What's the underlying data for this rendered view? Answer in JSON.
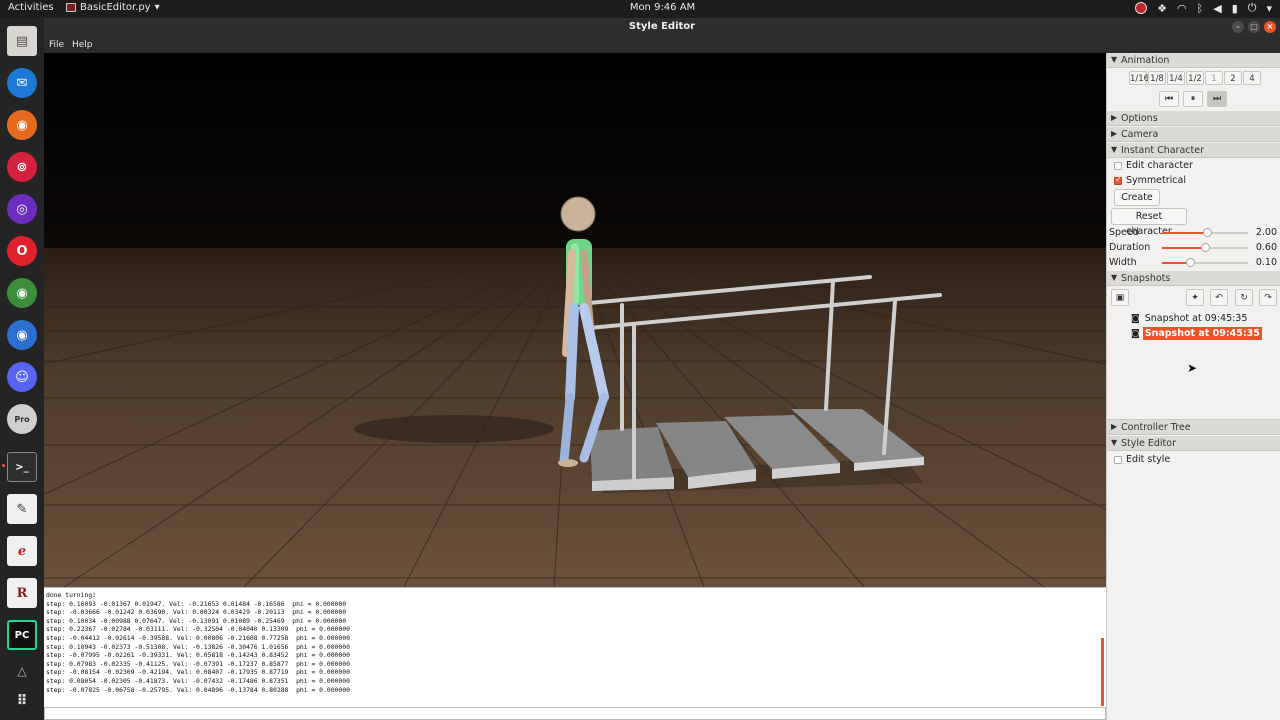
{
  "system": {
    "activities": "Activities",
    "app_name": "BasicEditor.py",
    "clock": "Mon  9:46 AM"
  },
  "window": {
    "title": "Style Editor"
  },
  "menu": {
    "file": "File",
    "help": "Help"
  },
  "dock": {
    "items": [
      "file-manager-icon",
      "thunderbird-icon",
      "firefox-icon",
      "app-icon-red",
      "app-icon-purple",
      "opera-icon",
      "chrome-icon",
      "chromium-icon",
      "discord-icon",
      "sheets-pro-icon",
      "terminal-icon",
      "text-editor-icon",
      "ebook-viewer-icon",
      "r-studio-icon",
      "pycharm-icon",
      "inkscape-icon",
      "show-apps-icon"
    ],
    "pro_label": "Pro",
    "r_label": "R",
    "pc_label": "PC"
  },
  "panel": {
    "animation": {
      "header": "Animation",
      "speeds": [
        "1/16",
        "1/8",
        "1/4",
        "1/2",
        "1",
        "2",
        "4"
      ]
    },
    "options_header": "Options",
    "camera_header": "Camera",
    "instant_character": {
      "header": "Instant Character",
      "edit_character": "Edit character",
      "symmetrical": "Symmetrical",
      "symmetrical_checked": true,
      "create_button": "Create",
      "reset_button": "Reset character",
      "sliders": [
        {
          "name": "Speed",
          "value": "2.00",
          "level": 0.52
        },
        {
          "name": "Duration",
          "value": "0.60",
          "level": 0.5
        },
        {
          "name": "Width",
          "value": "0.10",
          "level": 0.33
        }
      ]
    },
    "snapshots": {
      "header": "Snapshots",
      "items": [
        {
          "label": "Snapshot at 09:45:35",
          "selected": false
        },
        {
          "label": "Snapshot at 09:45:35",
          "selected": true
        }
      ]
    },
    "controller_tree_header": "Controller Tree",
    "style_editor": {
      "header": "Style Editor",
      "edit_style": "Edit style"
    }
  },
  "console": {
    "lines": [
      "done turning!",
      "step: 0.16093 -0.01367 0.01947. Vel: -0.21653 0.01484 -0.16586  phi = 0.000000",
      "step: -0.03666 -0.01242 0.03690. Vel: 0.00324 0.03429 -0.20113  phi = 0.000000",
      "step: 0.10034 -0.00988 0.07647. Vel: -0.13091 0.01089 -0.25469  phi = 0.000000",
      "step: 0.22367 -0.02784 -0.03111. Vel: -0.32504 -0.04040 0.13309  phi = 0.000000",
      "step: -0.04412 -0.02614 -0.39588. Vel: 0.00806 -0.21608 0.77258  phi = 0.000000",
      "step: 0.10943 -0.02373 -0.51308. Vel: -0.13826 -0.30476 1.01656  phi = 0.000000",
      "step: -0.07995 -0.02261 -0.39331. Vel: 0.05818 -0.14243 0.83452  phi = 0.000000",
      "step: 0.07983 -0.02335 -0.41125. Vel: -0.07391 -0.17237 0.85877  phi = 0.000000",
      "step: -0.08154 -0.02309 -0.42194. Vel: 0.08407 -0.17935 0.87719  phi = 0.000000",
      "step: 0.08054 -0.02305 -0.41873. Vel: -0.07432 -0.17486 0.87351  phi = 0.000000",
      "step: -0.07825 -0.06758 -0.25795. Vel: 0.04896 -0.13784 0.80288  phi = 0.000000"
    ]
  }
}
